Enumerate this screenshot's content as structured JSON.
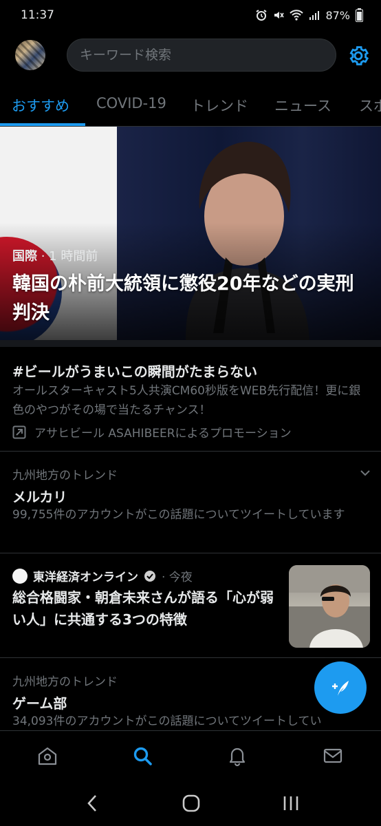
{
  "status_bar": {
    "time": "11:37",
    "battery": "87%"
  },
  "header": {
    "search_placeholder": "キーワード検索"
  },
  "tabs": [
    {
      "label": "おすすめ"
    },
    {
      "label": "COVID-19"
    },
    {
      "label": "トレンド"
    },
    {
      "label": "ニュース"
    },
    {
      "label": "スポ"
    }
  ],
  "hero": {
    "category": "国際",
    "time": "· 1 時間前",
    "title": "韓国の朴前大統領に懲役20年などの実刑判決"
  },
  "promo": {
    "title": "#ビールがうまいこの瞬間がたまらない",
    "description": "オールスターキャスト5人共演CM60秒版をWEB先行配信！更に銀色のやつがその場で当たるチャンス！",
    "promoted_by": "アサヒビール ASAHIBEERによるプロモーション"
  },
  "trends": [
    {
      "context": "九州地方のトレンド",
      "name": "メルカリ",
      "count": "99,755件のアカウントがこの話題についてツイートしています"
    },
    {
      "context": "九州地方のトレンド",
      "name": "ゲーム部",
      "count": "34,093件のアカウントがこの話題についてツイートしてい"
    }
  ],
  "news": {
    "source": "東洋経済オンライン",
    "time": "· 今夜",
    "title": "総合格闘家・朝倉未来さんが語る「心が弱い人」に共通する3つの特徴"
  },
  "colors": {
    "accent": "#1d9bf0",
    "background": "#000000",
    "muted": "#71767b"
  }
}
